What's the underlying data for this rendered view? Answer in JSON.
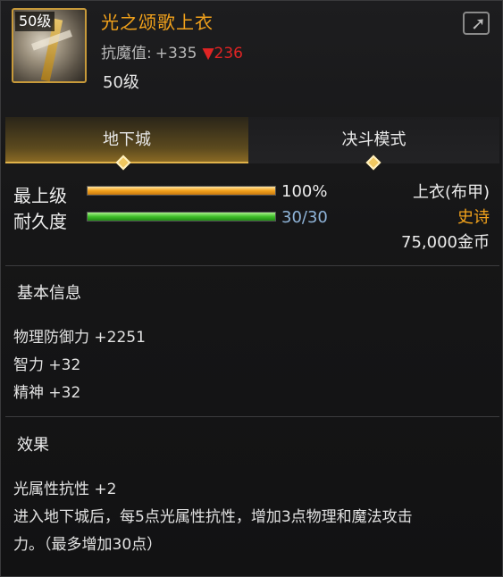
{
  "item": {
    "name": "光之颂歌上衣",
    "badge_level": "50级",
    "resist_label": "抗魔值:",
    "resist_value": "+335",
    "resist_diff": "▼236",
    "level_text": "50级",
    "icon": "armor-icon"
  },
  "share": {
    "icon": "share-icon"
  },
  "tabs": [
    {
      "label": "地下城",
      "active": true
    },
    {
      "label": "决斗模式",
      "active": false
    }
  ],
  "stats": {
    "grade_label": "最上级",
    "grade_value": "100%",
    "grade_fraction": 1.0,
    "durability_label": "耐久度",
    "durability_value": "30/30",
    "durability_fraction": 1.0
  },
  "info": {
    "type": "上衣(布甲)",
    "rarity": "史诗",
    "price": "75,000金币"
  },
  "basic": {
    "title": "基本信息",
    "lines": [
      "物理防御力 +2251",
      "智力 +32",
      "精神 +32"
    ]
  },
  "effect": {
    "title": "效果",
    "lines": [
      "光属性抗性 +2",
      "进入地下城后，每5点光属性抗性，增加3点物理和魔法攻击",
      "力。（最多增加30点）"
    ]
  },
  "colors": {
    "accent": "#f2a21b",
    "down": "#e02424",
    "durability_text": "#8fb4d9"
  }
}
